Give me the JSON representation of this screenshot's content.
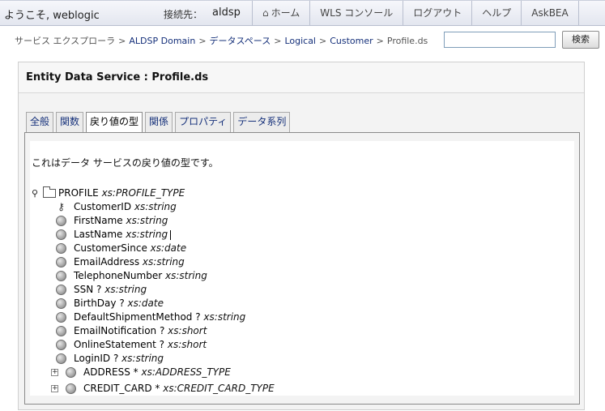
{
  "header": {
    "welcome": "ようこそ, weblogic",
    "server_label": "接続先：",
    "server_value": "aldsp",
    "nav": [
      {
        "label": "ホーム",
        "icon": "home-icon"
      },
      {
        "label": "WLS コンソール"
      },
      {
        "label": "ログアウト"
      },
      {
        "label": "ヘルプ"
      },
      {
        "label": "AskBEA"
      }
    ]
  },
  "breadcrumb": {
    "items": [
      "サービス エクスプローラ",
      "ALDSP Domain",
      "データスペース",
      "Logical",
      "Customer",
      "Profile.ds"
    ],
    "separator": ">"
  },
  "search": {
    "value": "",
    "button_label": "検索"
  },
  "panel": {
    "title": "Entity Data Service : Profile.ds",
    "tabs": [
      "全般",
      "関数",
      "戻り値の型",
      "関係",
      "プロパティ",
      "データ系列"
    ],
    "active_tab": "戻り値の型",
    "description": "これはデータ サービスの戻り値の型です。"
  },
  "tree": {
    "root": {
      "name": "PROFILE",
      "type": "xs:PROFILE_TYPE"
    },
    "fields": [
      {
        "name": "CustomerID",
        "type": "xs:string",
        "icon": "key-icon"
      },
      {
        "name": "FirstName",
        "type": "xs:string"
      },
      {
        "name": "LastName",
        "type": "xs:string"
      },
      {
        "name": "CustomerSince",
        "type": "xs:date"
      },
      {
        "name": "EmailAddress",
        "type": "xs:string"
      },
      {
        "name": "TelephoneNumber",
        "type": "xs:string"
      },
      {
        "name": "SSN ?",
        "type": "xs:string"
      },
      {
        "name": "BirthDay ?",
        "type": "xs:date"
      },
      {
        "name": "DefaultShipmentMethod ?",
        "type": "xs:string"
      },
      {
        "name": "EmailNotification ?",
        "type": "xs:short"
      },
      {
        "name": "OnlineStatement ?",
        "type": "xs:short"
      },
      {
        "name": "LoginID ?",
        "type": "xs:string"
      }
    ],
    "children": [
      {
        "name": "ADDRESS *",
        "type": "xs:ADDRESS_TYPE"
      },
      {
        "name": "CREDIT_CARD *",
        "type": "xs:CREDIT_CARD_TYPE"
      }
    ]
  },
  "colors": {
    "link": "#15307a",
    "topbar": "#e3e6ef"
  }
}
